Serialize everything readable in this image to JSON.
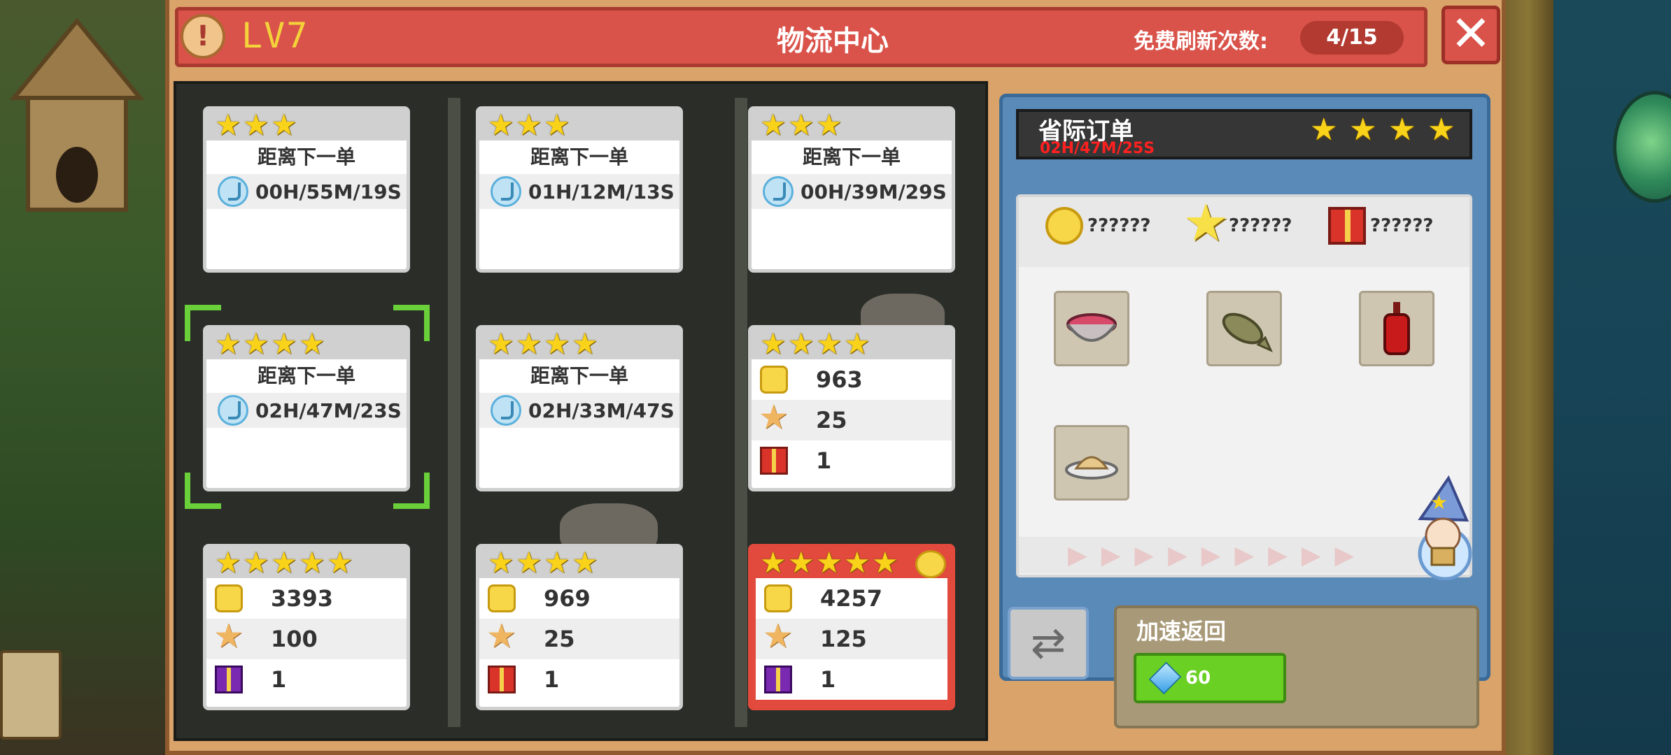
{
  "header": {
    "level": "LV7",
    "title": "物流中心",
    "refresh_label": "免费刷新次数:",
    "refresh_count": "4/15"
  },
  "cards": [
    {
      "stars": 3,
      "wait_label": "距离下一单",
      "timer": "00H/55M/19S"
    },
    {
      "stars": 3,
      "wait_label": "距离下一单",
      "timer": "01H/12M/13S"
    },
    {
      "stars": 3,
      "wait_label": "距离下一单",
      "timer": "00H/39M/29S"
    },
    {
      "stars": 4,
      "wait_label": "距离下一单",
      "timer": "02H/47M/23S"
    },
    {
      "stars": 4,
      "wait_label": "距离下一单",
      "timer": "02H/33M/47S"
    },
    {
      "stars": 4,
      "coins": "963",
      "star_reward": "25",
      "gifts": "1"
    },
    {
      "stars": 5,
      "coins": "3393",
      "star_reward": "100",
      "gifts": "1"
    },
    {
      "stars": 4,
      "coins": "969",
      "star_reward": "25",
      "gifts": "1"
    },
    {
      "stars": 5,
      "coins": "4257",
      "star_reward": "125",
      "gifts": "1"
    }
  ],
  "order": {
    "title": "省际订单",
    "timer": "02H/47M/25S",
    "stars": 4,
    "coin_reward": "??????",
    "star_reward": "??????",
    "gift_reward": "??????",
    "items": [
      "meat-bowl-icon",
      "fish-icon",
      "sauce-bottle-icon",
      "flour-plate-icon"
    ]
  },
  "speedup": {
    "label": "加速返回",
    "cost": "60"
  },
  "colors": {
    "title_bar": "#d9534a",
    "selected_card": "#e14a3c",
    "speed_button": "#6ad024",
    "timer_red": "#ff2020"
  }
}
